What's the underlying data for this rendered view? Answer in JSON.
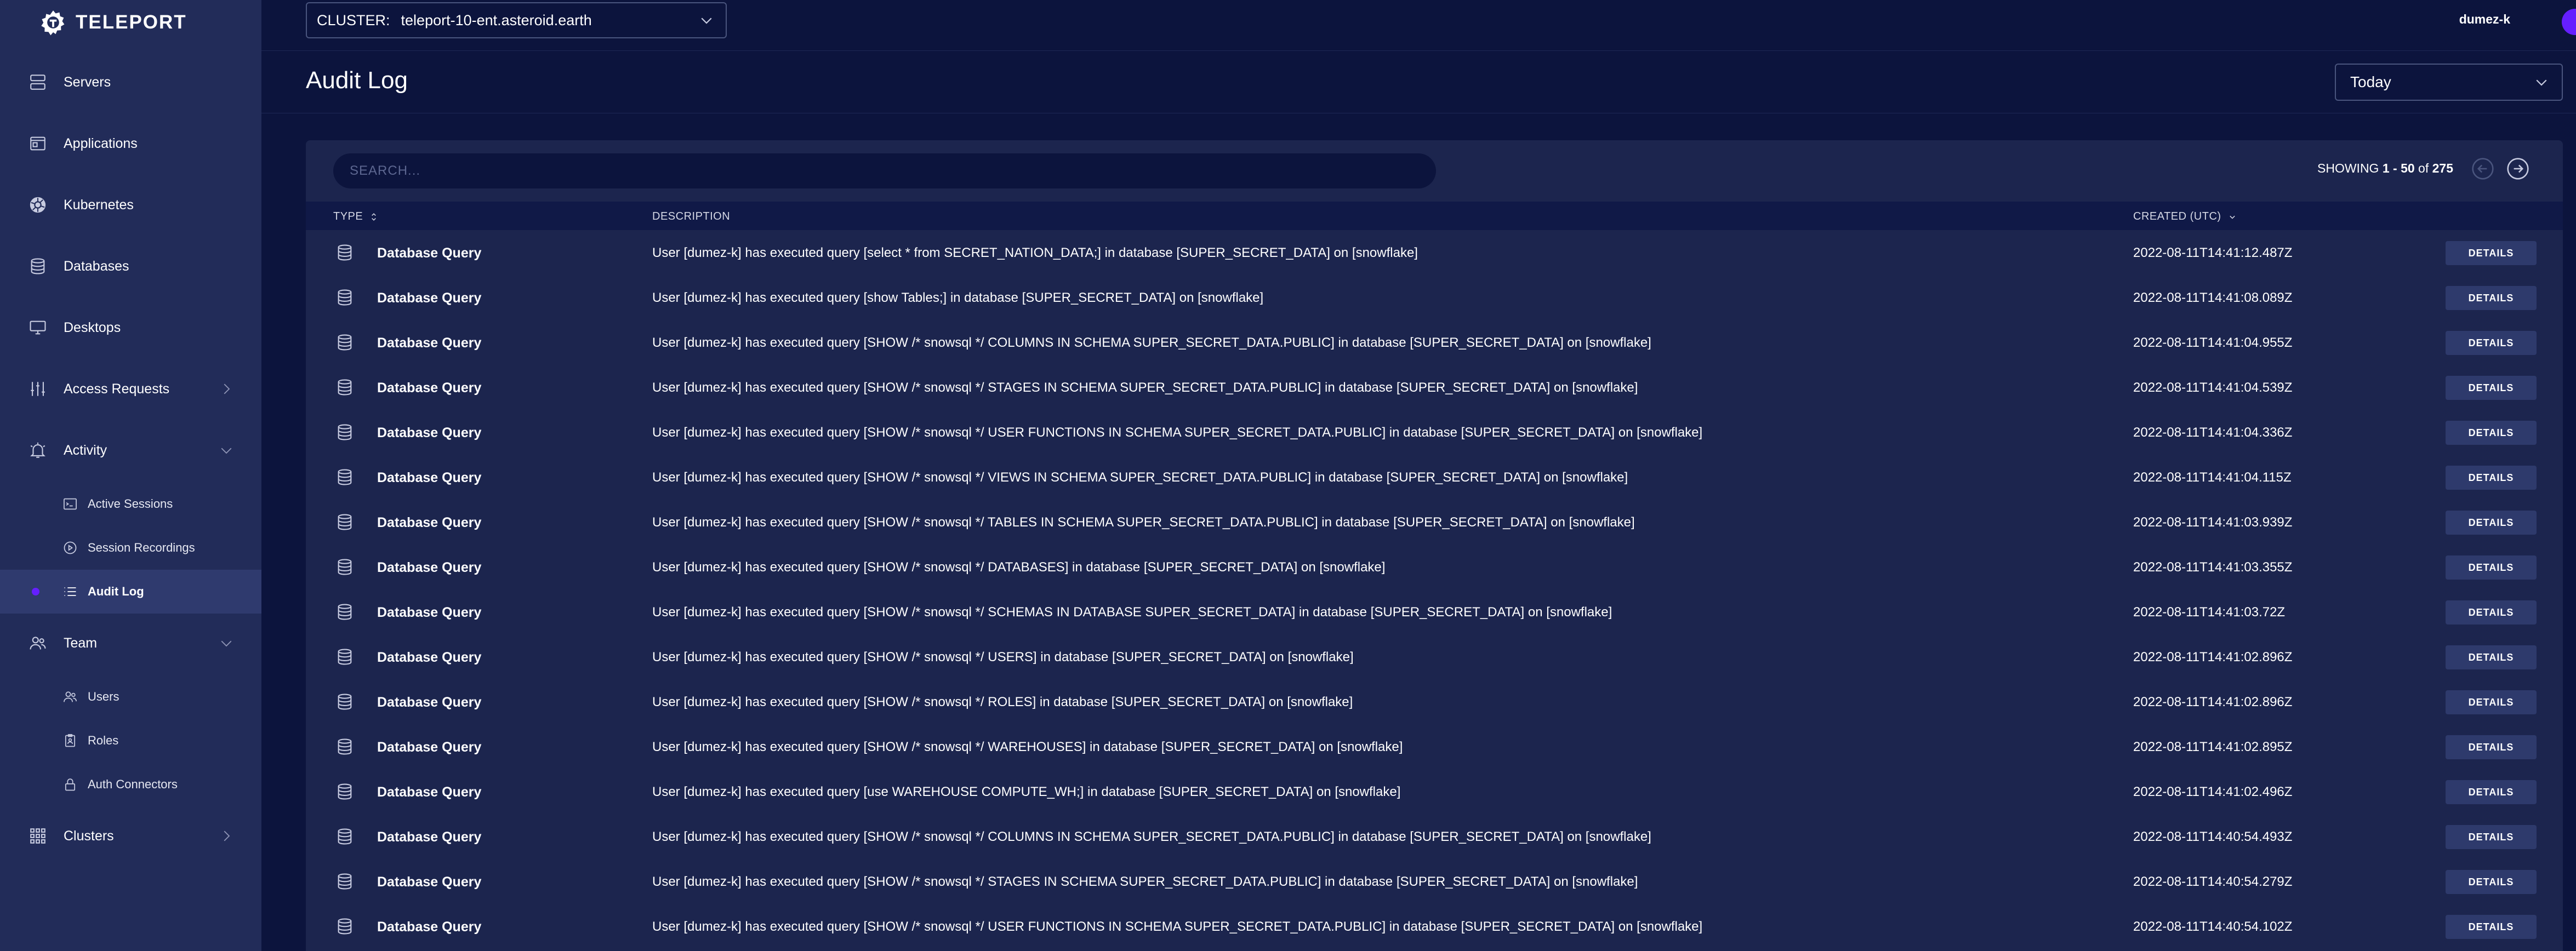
{
  "brand": {
    "name": "TELEPORT"
  },
  "colors": {
    "accent": "#651fff",
    "sidebar_bg": "#222c59",
    "page_bg": "#0c143d",
    "panel_bg": "#1c254e"
  },
  "sidebar": {
    "items": [
      {
        "label": "Servers",
        "icon": "server-icon"
      },
      {
        "label": "Applications",
        "icon": "application-icon"
      },
      {
        "label": "Kubernetes",
        "icon": "kubernetes-icon"
      },
      {
        "label": "Databases",
        "icon": "database-icon"
      },
      {
        "label": "Desktops",
        "icon": "desktop-icon"
      },
      {
        "label": "Access Requests",
        "icon": "sliders-icon"
      },
      {
        "label": "Activity",
        "icon": "bell-icon"
      },
      {
        "label": "Team",
        "icon": "users-icon"
      },
      {
        "label": "Clusters",
        "icon": "grid-icon"
      }
    ],
    "activity_sub": [
      {
        "label": "Active Sessions",
        "icon": "terminal-icon"
      },
      {
        "label": "Session Recordings",
        "icon": "play-icon"
      },
      {
        "label": "Audit Log",
        "icon": "list-icon",
        "active": true
      }
    ],
    "team_sub": [
      {
        "label": "Users",
        "icon": "users-icon"
      },
      {
        "label": "Roles",
        "icon": "clipboard-icon"
      },
      {
        "label": "Auth Connectors",
        "icon": "lock-icon"
      }
    ]
  },
  "topbar": {
    "cluster_prefix": "CLUSTER:",
    "cluster_value": "teleport-10-ent.asteroid.earth",
    "username": "dumez-k"
  },
  "page": {
    "title": "Audit Log",
    "range": "Today"
  },
  "search": {
    "placeholder": "SEARCH..."
  },
  "pagination": {
    "prefix": "SHOWING ",
    "range": "1 - 50",
    "of": " of ",
    "total": "275"
  },
  "table": {
    "headers": {
      "type": "TYPE",
      "description": "DESCRIPTION",
      "created": "CREATED (UTC)"
    },
    "details_label": "DETAILS",
    "rows": [
      {
        "type": "Database Query",
        "description": "User [dumez-k] has executed query [select * from SECRET_NATION_DATA;] in database [SUPER_SECRET_DATA] on [snowflake]",
        "created": "2022-08-11T14:41:12.487Z"
      },
      {
        "type": "Database Query",
        "description": "User [dumez-k] has executed query [show Tables;] in database [SUPER_SECRET_DATA] on [snowflake]",
        "created": "2022-08-11T14:41:08.089Z"
      },
      {
        "type": "Database Query",
        "description": "User [dumez-k] has executed query [SHOW /* snowsql */ COLUMNS IN SCHEMA SUPER_SECRET_DATA.PUBLIC] in database [SUPER_SECRET_DATA] on [snowflake]",
        "created": "2022-08-11T14:41:04.955Z"
      },
      {
        "type": "Database Query",
        "description": "User [dumez-k] has executed query [SHOW /* snowsql */ STAGES IN SCHEMA SUPER_SECRET_DATA.PUBLIC] in database [SUPER_SECRET_DATA] on [snowflake]",
        "created": "2022-08-11T14:41:04.539Z"
      },
      {
        "type": "Database Query",
        "description": "User [dumez-k] has executed query [SHOW /* snowsql */ USER FUNCTIONS IN SCHEMA SUPER_SECRET_DATA.PUBLIC] in database [SUPER_SECRET_DATA] on [snowflake]",
        "created": "2022-08-11T14:41:04.336Z"
      },
      {
        "type": "Database Query",
        "description": "User [dumez-k] has executed query [SHOW /* snowsql */ VIEWS IN SCHEMA SUPER_SECRET_DATA.PUBLIC] in database [SUPER_SECRET_DATA] on [snowflake]",
        "created": "2022-08-11T14:41:04.115Z"
      },
      {
        "type": "Database Query",
        "description": "User [dumez-k] has executed query [SHOW /* snowsql */ TABLES IN SCHEMA SUPER_SECRET_DATA.PUBLIC] in database [SUPER_SECRET_DATA] on [snowflake]",
        "created": "2022-08-11T14:41:03.939Z"
      },
      {
        "type": "Database Query",
        "description": "User [dumez-k] has executed query [SHOW /* snowsql */ DATABASES] in database [SUPER_SECRET_DATA] on [snowflake]",
        "created": "2022-08-11T14:41:03.355Z"
      },
      {
        "type": "Database Query",
        "description": "User [dumez-k] has executed query [SHOW /* snowsql */ SCHEMAS IN DATABASE SUPER_SECRET_DATA] in database [SUPER_SECRET_DATA] on [snowflake]",
        "created": "2022-08-11T14:41:03.72Z"
      },
      {
        "type": "Database Query",
        "description": "User [dumez-k] has executed query [SHOW /* snowsql */ USERS] in database [SUPER_SECRET_DATA] on [snowflake]",
        "created": "2022-08-11T14:41:02.896Z"
      },
      {
        "type": "Database Query",
        "description": "User [dumez-k] has executed query [SHOW /* snowsql */ ROLES] in database [SUPER_SECRET_DATA] on [snowflake]",
        "created": "2022-08-11T14:41:02.896Z"
      },
      {
        "type": "Database Query",
        "description": "User [dumez-k] has executed query [SHOW /* snowsql */ WAREHOUSES] in database [SUPER_SECRET_DATA] on [snowflake]",
        "created": "2022-08-11T14:41:02.895Z"
      },
      {
        "type": "Database Query",
        "description": "User [dumez-k] has executed query [use WAREHOUSE COMPUTE_WH;] in database [SUPER_SECRET_DATA] on [snowflake]",
        "created": "2022-08-11T14:41:02.496Z"
      },
      {
        "type": "Database Query",
        "description": "User [dumez-k] has executed query [SHOW /* snowsql */ COLUMNS IN SCHEMA SUPER_SECRET_DATA.PUBLIC] in database [SUPER_SECRET_DATA] on [snowflake]",
        "created": "2022-08-11T14:40:54.493Z"
      },
      {
        "type": "Database Query",
        "description": "User [dumez-k] has executed query [SHOW /* snowsql */ STAGES IN SCHEMA SUPER_SECRET_DATA.PUBLIC] in database [SUPER_SECRET_DATA] on [snowflake]",
        "created": "2022-08-11T14:40:54.279Z"
      },
      {
        "type": "Database Query",
        "description": "User [dumez-k] has executed query [SHOW /* snowsql */ USER FUNCTIONS IN SCHEMA SUPER_SECRET_DATA.PUBLIC] in database [SUPER_SECRET_DATA] on [snowflake]",
        "created": "2022-08-11T14:40:54.102Z"
      }
    ]
  }
}
